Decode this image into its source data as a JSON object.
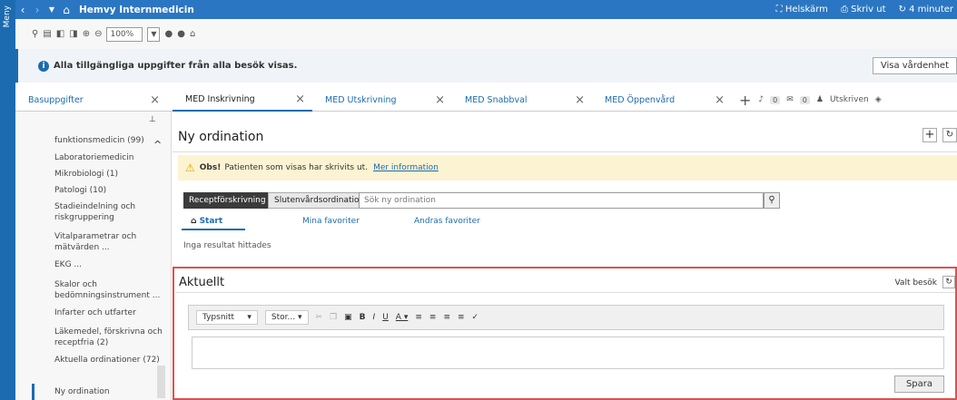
{
  "app": {
    "menu_label": "Meny",
    "title": "Hemvy Internmedicin",
    "fullscreen": "Helskärm",
    "print": "Skriv ut",
    "refresh": "4 minuter"
  },
  "toolbar": {
    "zoom": "100%"
  },
  "info": {
    "message": "Alla tillgängliga uppgifter från alla besök visas.",
    "button": "Visa vårdenhet"
  },
  "tabs": [
    {
      "label": "Basuppgifter"
    },
    {
      "label": "MED Inskrivning"
    },
    {
      "label": "MED Utskrivning"
    },
    {
      "label": "MED Snabbval"
    },
    {
      "label": "MED Öppenvård"
    }
  ],
  "status": {
    "count1": "0",
    "count2": "0",
    "patient": "Utskriven"
  },
  "sidebar": {
    "items": [
      "funktionsmedicin (99)",
      "Laboratoriemedicin",
      "Mikrobiologi (1)",
      "Patologi (10)",
      "Stadieindelning och riskgruppering",
      "Vitalparametrar och mätvärden ...",
      "EKG ...",
      "Skalor och bedömningsinstrument ...",
      "Infarter och utfarter",
      "Läkemedel, förskrivna och receptfria (2)",
      "Aktuella ordinationer (72)",
      "Ny ordination"
    ]
  },
  "main": {
    "title": "Ny ordination",
    "warning_bold": "Obs!",
    "warning_text": "Patienten som visas har skrivits ut.",
    "warning_link": "Mer information",
    "btn_recept": "Receptförskrivning",
    "btn_sluten": "Slutenvårdsordination",
    "search_placeholder": "Sök ny ordination",
    "subtab_start": "Start",
    "subtab_mina": "Mina favoriter",
    "subtab_andras": "Andras favoriter",
    "no_results": "Inga resultat hittades"
  },
  "aktuellt": {
    "title": "Aktuellt",
    "valt": "Valt besök",
    "font": "Typsnitt",
    "size": "Stor...",
    "save": "Spara"
  }
}
